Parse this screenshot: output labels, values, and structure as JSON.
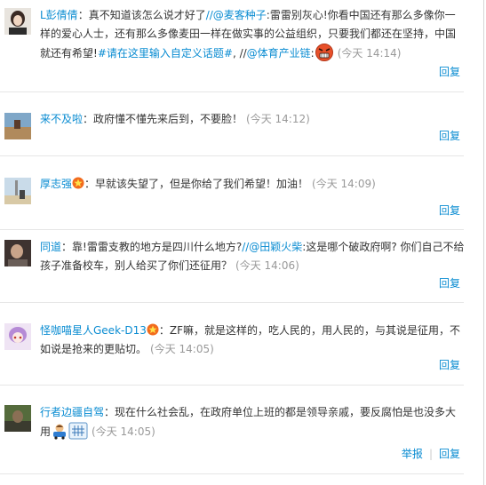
{
  "comments": [
    {
      "user": "L彭倩倩",
      "text1": "：真不知道该怎么说才好了",
      "mention1": "//@麦客种子",
      "text2": ":雷雷别灰心!你看中国还有那么多像你一样的爱心人士，还有那么多像麦田一样在做实事的公益组织，只要我们都还在坚持，中国就还有希望!",
      "topic": "#请在这里输入自定义话题#",
      "text3": ", //",
      "mention2": "@体育产业链",
      "text4": ":",
      "time": "(今天 14:14)",
      "reply": "回复"
    },
    {
      "user": "来不及啦",
      "text": "：政府懂不懂先来后到，不要脸！",
      "time": "(今天 14:12)",
      "reply": "回复"
    },
    {
      "user": "厚志强",
      "text": "：早就该失望了，但是你给了我们希望！加油！",
      "time": "(今天 14:09)",
      "reply": "回复"
    },
    {
      "user": "同道",
      "text1": "：靠!雷雷支教的地方是四川什么地方?",
      "mention": "//@田颖火柴",
      "text2": ":这是哪个破政府啊? 你们自己不给孩子准备校车，别人给买了你们还征用？",
      "time": "(今天 14:06)",
      "reply": "回复"
    },
    {
      "user": "怪咖喵星人Geek-D13",
      "text": "：ZF嘛，就是这样的，吃人民的，用人民的，与其说是征用，不如说是抢来的更贴切。",
      "time": "(今天 14:05)",
      "reply": "回复"
    },
    {
      "user": "行者边疆自驾",
      "text": "：现在什么社会乱，在政府单位上班的都是领导亲戚，要反腐怕是也没多大用",
      "time": "(今天 14:05)",
      "report": "举报",
      "reply": "回复"
    }
  ],
  "colors": {
    "link": "#0a8cd2",
    "time": "#999999",
    "text": "#333333"
  },
  "icons": [
    "angry-face-emoticon",
    "vip-star-badge",
    "car-emoticon",
    "grid-emoticon"
  ]
}
